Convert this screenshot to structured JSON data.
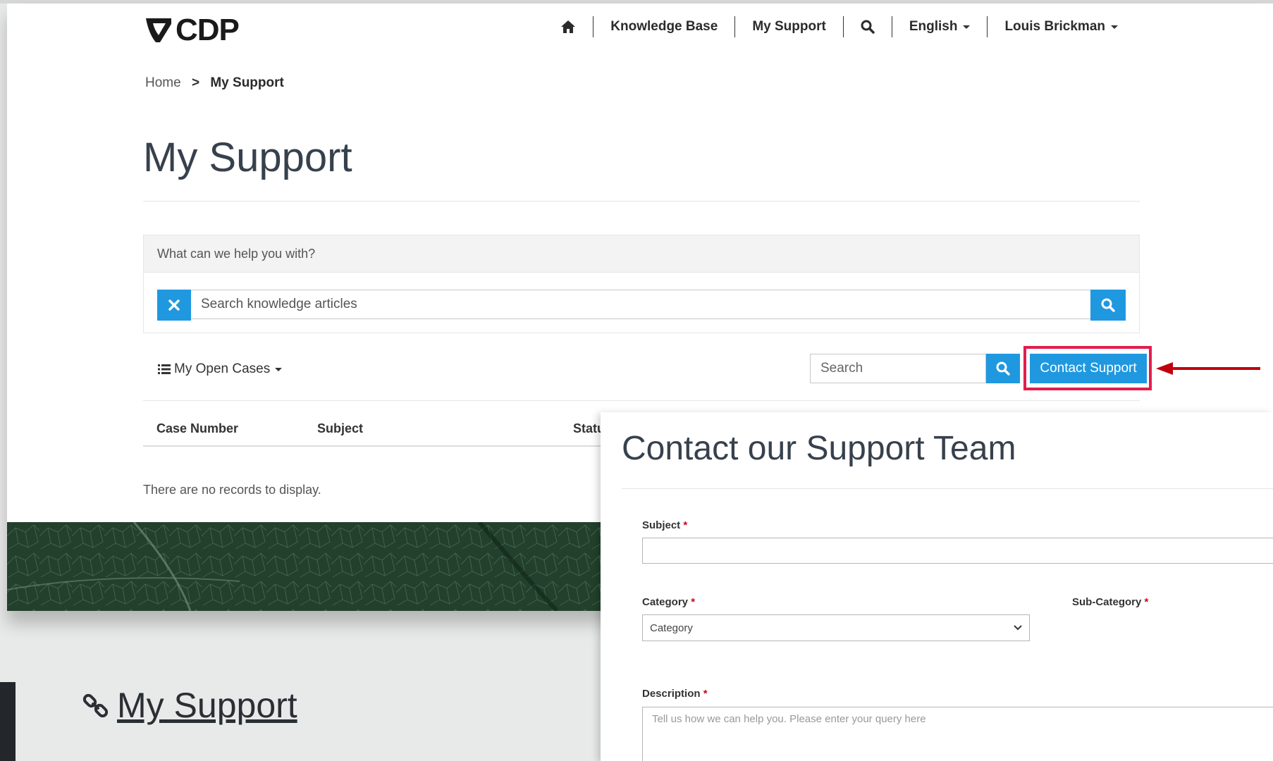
{
  "brand": {
    "name": "CDP"
  },
  "nav": {
    "home_icon": "home-icon",
    "knowledge_base": "Knowledge Base",
    "my_support": "My Support",
    "search_icon": "search-icon",
    "language": "English",
    "user": "Louis Brickman"
  },
  "breadcrumb": {
    "home": "Home",
    "separator": ">",
    "current": "My Support"
  },
  "page": {
    "title": "My Support"
  },
  "help": {
    "heading": "What can we help you with?",
    "search_placeholder": "Search knowledge articles",
    "clear_icon": "close-icon",
    "search_icon": "search-icon"
  },
  "cases": {
    "view_label": "My Open Cases",
    "search_placeholder": "Search",
    "contact_button": "Contact Support",
    "columns": [
      "Case Number",
      "Subject",
      "Status"
    ],
    "empty_message": "There are no records to display."
  },
  "doc_link": {
    "text": "My Support",
    "icon": "link-icon"
  },
  "contact_form": {
    "title": "Contact our Support Team",
    "subject_label": "Subject",
    "category_label": "Category",
    "category_value": "Category",
    "subcategory_label": "Sub-Category",
    "description_label": "Description",
    "description_placeholder": "Tell us how we can help you. Please enter your query here",
    "required_mark": "*"
  },
  "colors": {
    "accent": "#1f98e0",
    "highlight": "#e21d4c",
    "arrow": "#c0000f",
    "title_text": "#37414d"
  }
}
